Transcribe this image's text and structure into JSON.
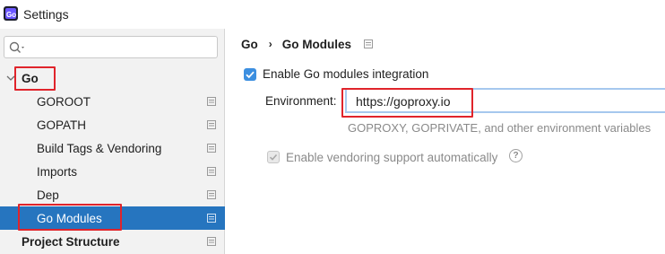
{
  "window": {
    "title": "Settings"
  },
  "sidebar": {
    "search": {
      "placeholder": "",
      "value": ""
    },
    "items": [
      {
        "label": "Go",
        "level": 0,
        "expanded": true,
        "bold": true,
        "highlighted": true
      },
      {
        "label": "GOROOT",
        "level": 1
      },
      {
        "label": "GOPATH",
        "level": 1
      },
      {
        "label": "Build Tags & Vendoring",
        "level": 1
      },
      {
        "label": "Imports",
        "level": 1
      },
      {
        "label": "Dep",
        "level": 1
      },
      {
        "label": "Go Modules",
        "level": 1,
        "selected": true,
        "highlighted": true
      },
      {
        "label": "Project Structure",
        "level": 0,
        "bold": true
      }
    ]
  },
  "main": {
    "breadcrumb": [
      "Go",
      "Go Modules"
    ],
    "enable_modules": {
      "label": "Enable Go modules integration",
      "checked": true
    },
    "environment": {
      "label": "Environment:",
      "value": "https://goproxy.io",
      "hint": "GOPROXY, GOPRIVATE, and other environment variables"
    },
    "vendoring": {
      "label": "Enable vendoring support automatically",
      "checked": true,
      "disabled": true
    }
  },
  "colors": {
    "accent": "#2675bf",
    "checkbox": "#3c8fe0",
    "annotation": "#e0242b",
    "focus_border": "#a6c8ee"
  },
  "icons": {
    "app": "goland-icon",
    "search": "search-icon",
    "page": "settings-page-icon",
    "help": "help-icon"
  }
}
